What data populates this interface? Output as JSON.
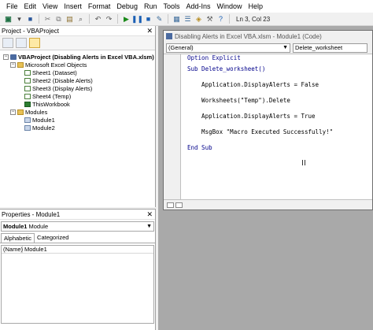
{
  "menu": [
    "File",
    "Edit",
    "View",
    "Insert",
    "Format",
    "Debug",
    "Run",
    "Tools",
    "Add-Ins",
    "Window",
    "Help"
  ],
  "toolbar": {
    "status": "Ln 3, Col 23"
  },
  "project": {
    "title": "Project - VBAProject",
    "root": "VBAProject (Disabling Alerts in Excel VBA.xlsm)",
    "objects_folder": "Microsoft Excel Objects",
    "sheets": [
      "Sheet1 (Dataset)",
      "Sheet2 (Disable Alerts)",
      "Sheet3 (Display Alerts)",
      "Sheet4 (Temp)"
    ],
    "workbook": "ThisWorkbook",
    "modules_folder": "Modules",
    "modules": [
      "Module1",
      "Module2"
    ]
  },
  "properties": {
    "title": "Properties - Module1",
    "object_name": "Module1",
    "object_type": "Module",
    "tabs": [
      "Alphabetic",
      "Categorized"
    ],
    "row_name": "(Name)",
    "row_value": "Module1"
  },
  "codewindow": {
    "title": "Disabling Alerts in Excel VBA.xlsm - Module1 (Code)",
    "object_combo": "(General)",
    "proc_combo": "Delete_worksheet",
    "lines": [
      "Option Explicit",
      "",
      "Sub Delete_worksheet()",
      "",
      "    Application.DisplayAlerts = False",
      "",
      "    Worksheets(\"Temp\").Delete",
      "",
      "    Application.DisplayAlerts = True",
      "",
      "    MsgBox \"Macro Executed Successfully!\"",
      "",
      "End Sub"
    ]
  }
}
